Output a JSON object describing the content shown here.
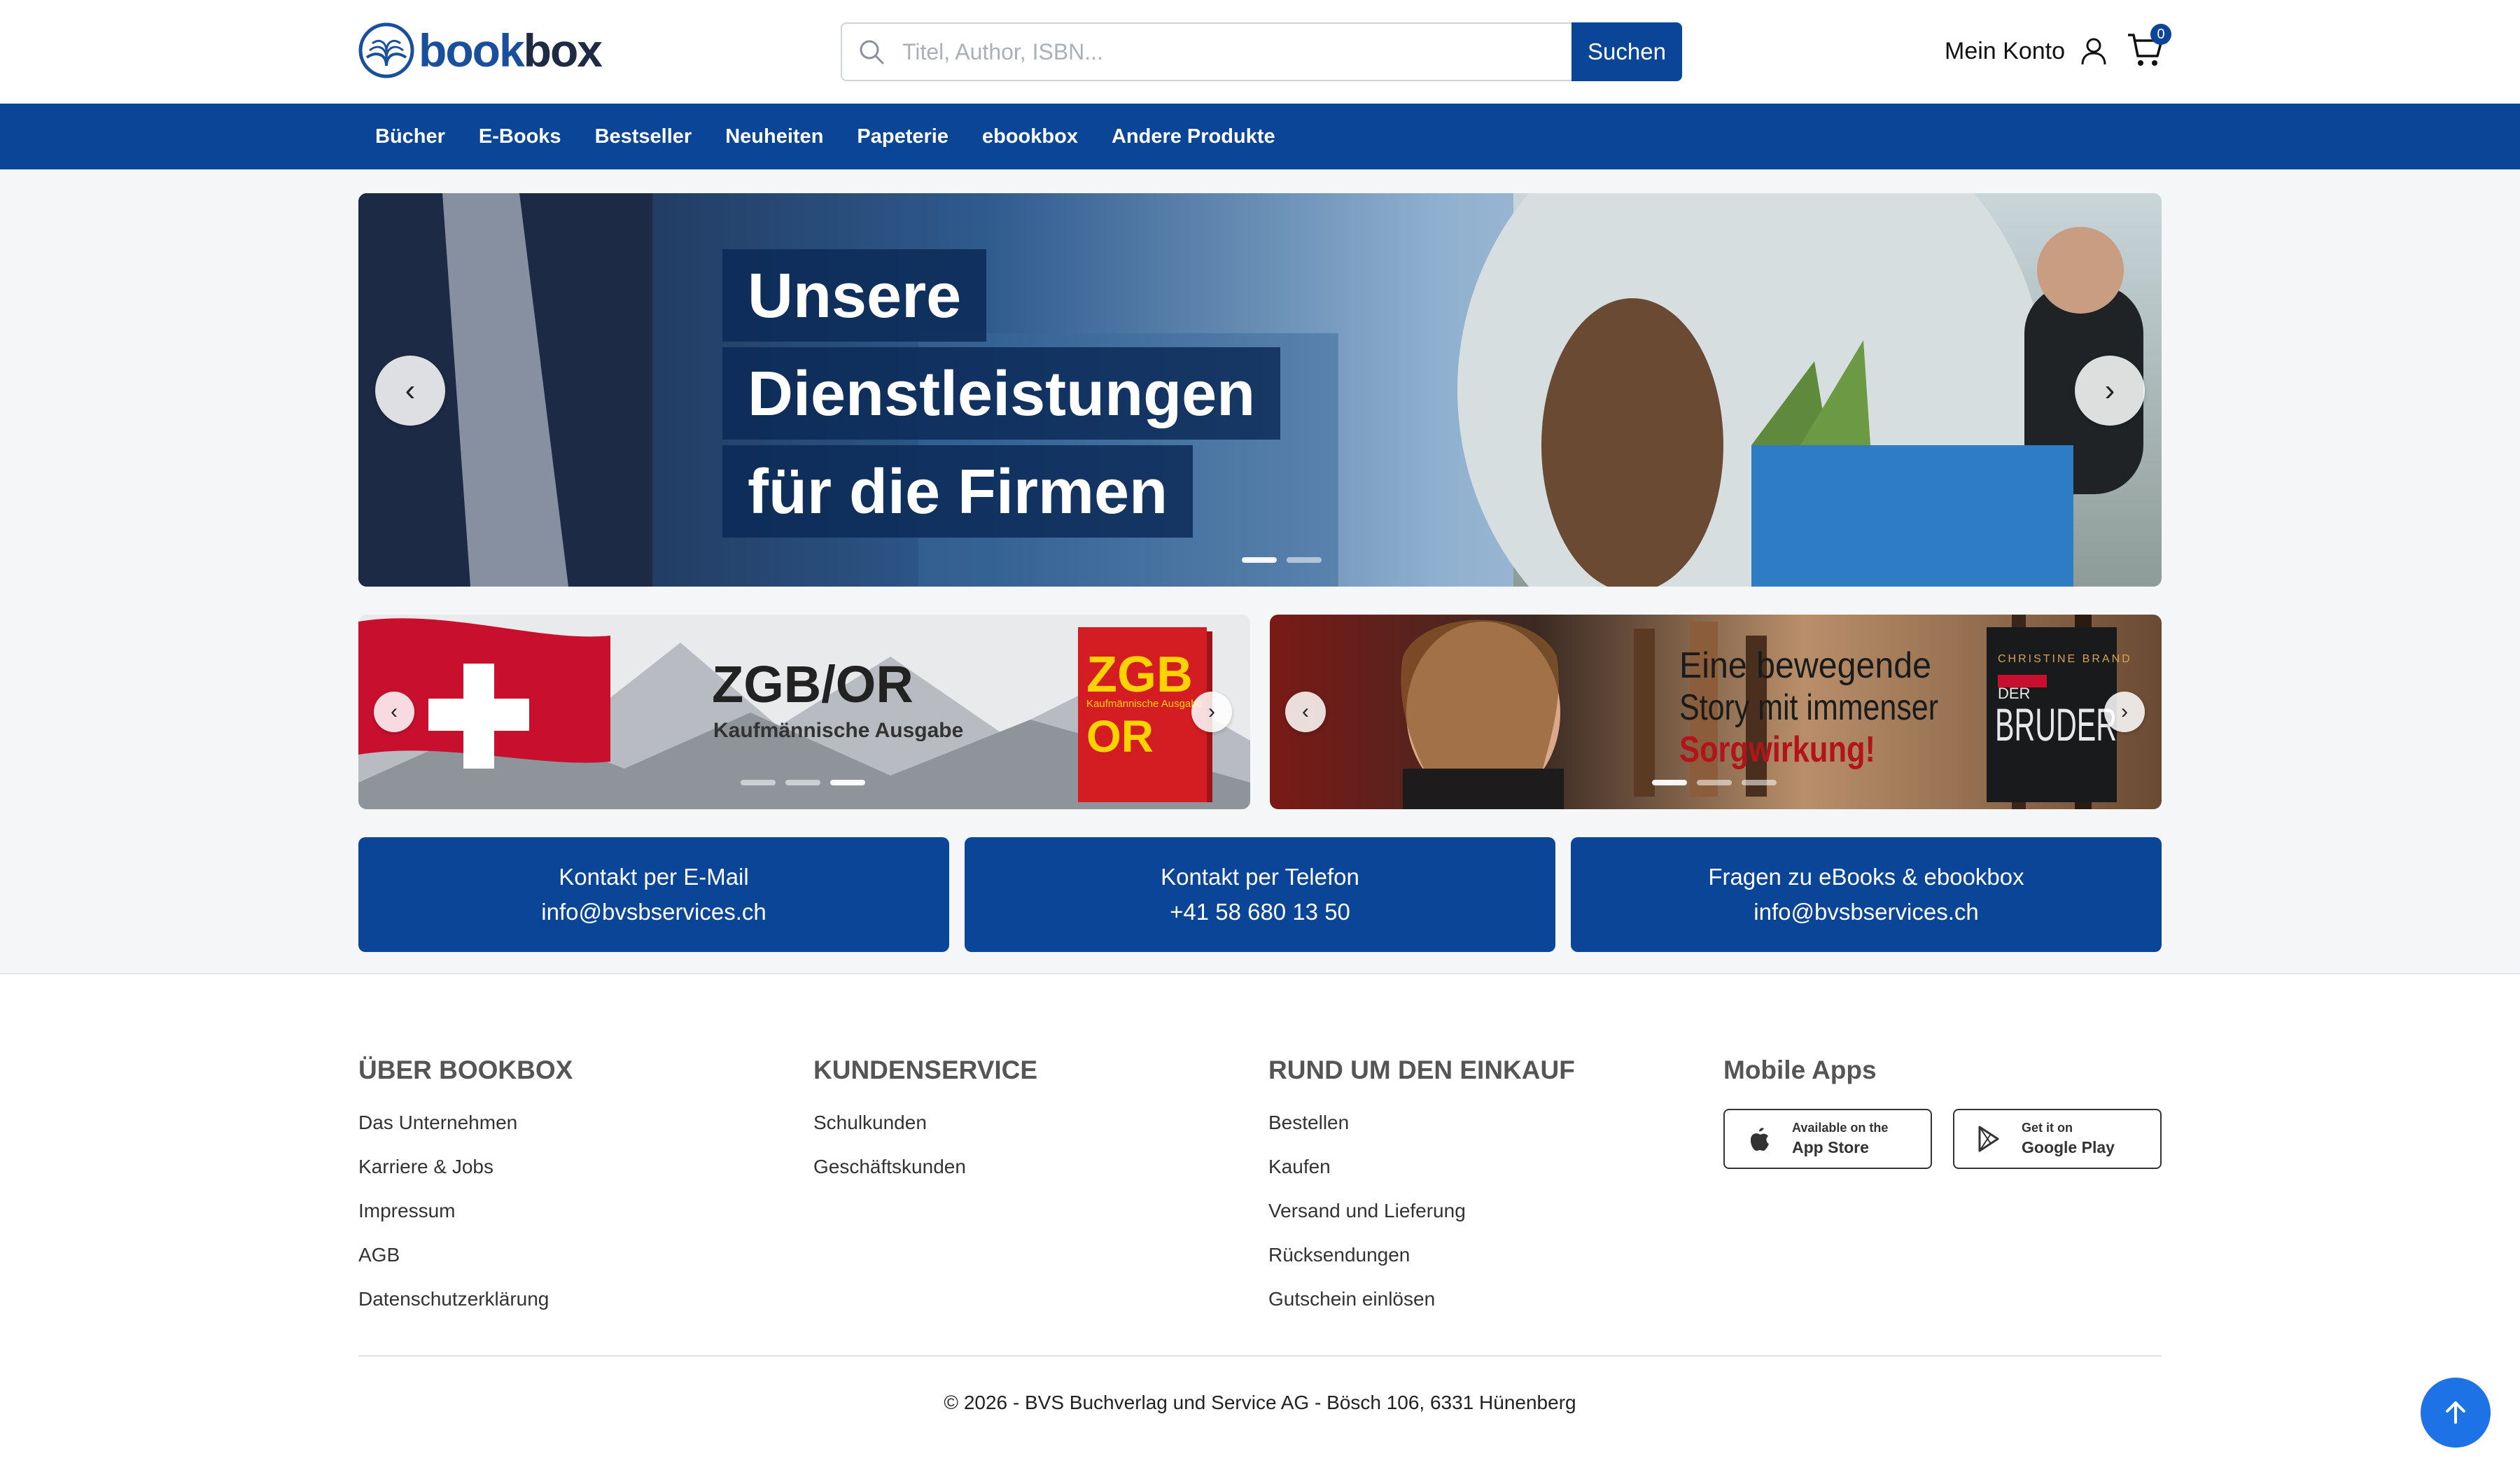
{
  "header": {
    "logo": {
      "part1": "book",
      "part2": "box"
    },
    "search": {
      "placeholder": "Titel, Author, ISBN...",
      "button_label": "Suchen"
    },
    "account_label": "Mein Konto",
    "cart_count": "0"
  },
  "nav": {
    "items": [
      "Bücher",
      "E-Books",
      "Bestseller",
      "Neuheiten",
      "Papeterie",
      "ebookbox",
      "Andere Produkte"
    ]
  },
  "hero": {
    "lines": [
      "Unsere",
      "Dienstleistungen",
      "für die Firmen"
    ],
    "prev": "‹",
    "next": "›",
    "slides": 2,
    "active_slide": 1
  },
  "banners": [
    {
      "title": "ZGB/OR",
      "subtitle": "Kaufmännische Ausgabe",
      "book_title": "ZGB",
      "book_title2": "OR",
      "book_sub": "Kaufmännische Ausgabe",
      "slides": 3,
      "active_slide": 3
    },
    {
      "line1": "Eine bewegende",
      "line2": "Story mit immenser",
      "line3": "Sorgwirkung!",
      "book_author": "CHRISTINE BRAND",
      "book_title": "DER BRUDER",
      "slides": 3,
      "active_slide": 1
    }
  ],
  "contacts": [
    {
      "title": "Kontakt per E-Mail",
      "value": "info@bvsbservices.ch"
    },
    {
      "title": "Kontakt per Telefon",
      "value": "+41 58 680 13 50"
    },
    {
      "title": "Fragen zu eBooks & ebookbox",
      "value": "info@bvsbservices.ch"
    }
  ],
  "footer": {
    "about": {
      "heading": "ÜBER BOOKBOX",
      "links": [
        "Das Unternehmen",
        "Karriere & Jobs",
        "Impressum",
        "AGB",
        "Datenschutzerklärung"
      ]
    },
    "service": {
      "heading": "KUNDENSERVICE",
      "links": [
        "Schulkunden",
        "Geschäftskunden"
      ]
    },
    "shopping": {
      "heading": "RUND UM DEN EINKAUF",
      "links": [
        "Bestellen",
        "Kaufen",
        "Versand und Lieferung",
        "Rücksendungen",
        "Gutschein einlösen"
      ]
    },
    "apps": {
      "heading": "Mobile Apps",
      "appstore": {
        "line1": "Available on the",
        "line2": "App Store"
      },
      "googleplay": {
        "line1": "Get it on",
        "line2": "Google Play"
      }
    },
    "copyright": "© 2026 - BVS Buchverlag und Service AG - Bösch 106, 6331 Hünenberg"
  },
  "colors": {
    "primary": "#0b4597",
    "accent": "#1d72e6",
    "logo_blue": "#1a4f9c"
  }
}
